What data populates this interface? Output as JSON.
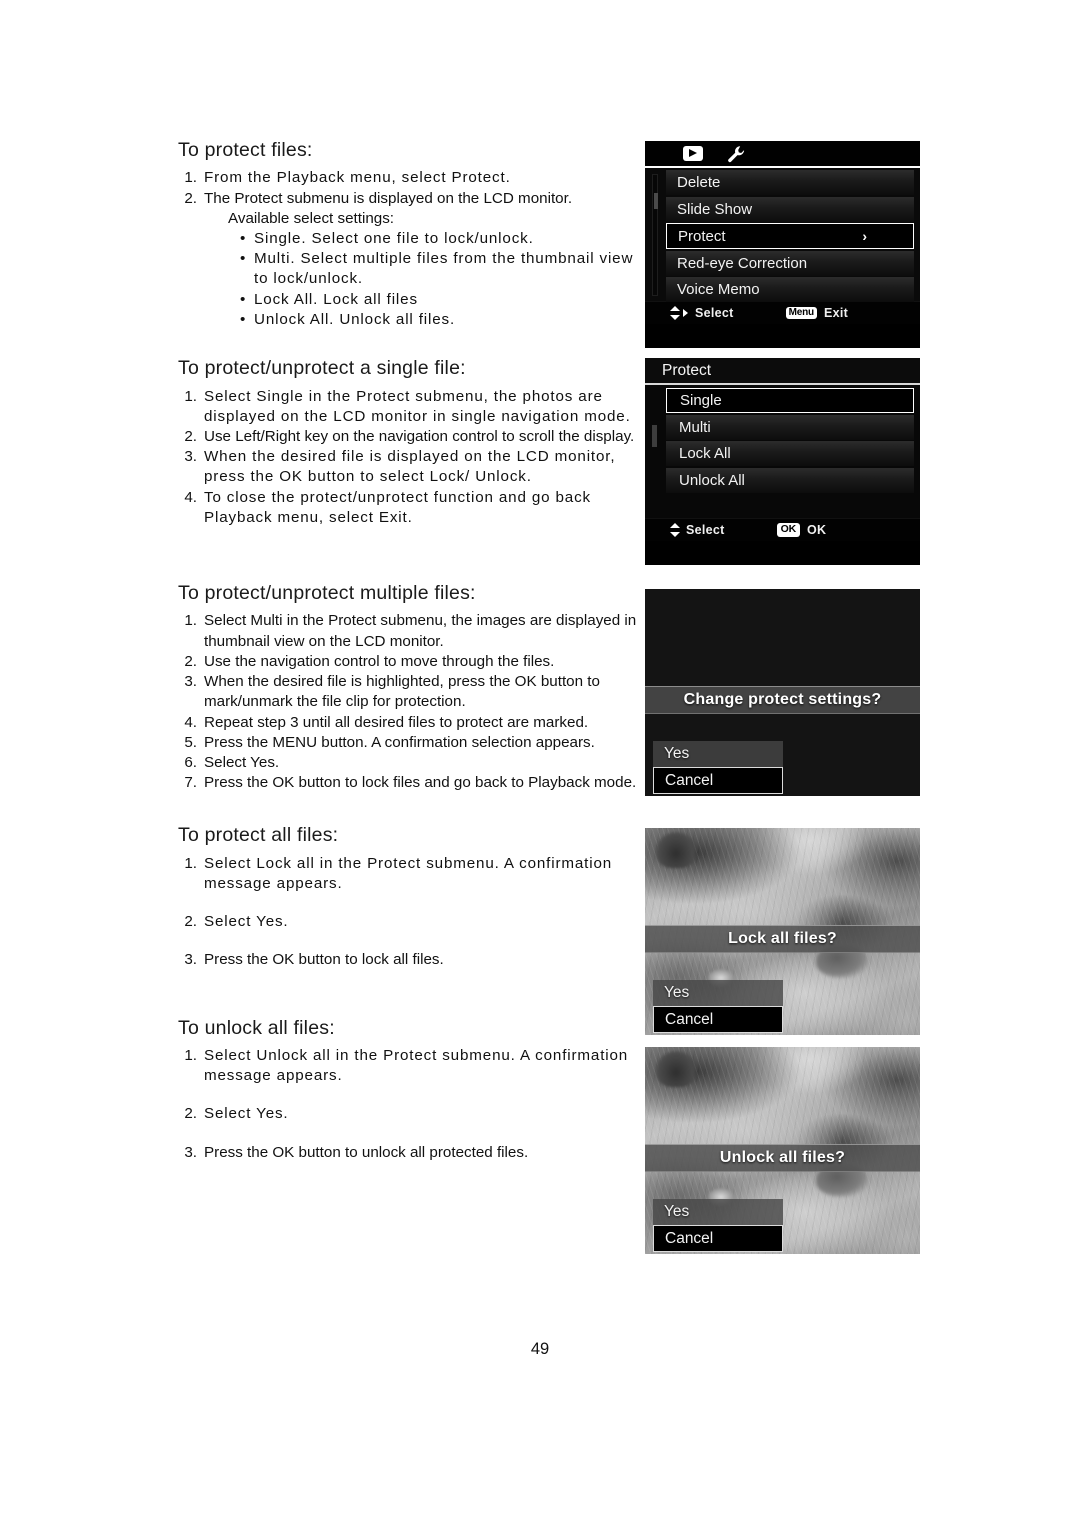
{
  "page": {
    "number": "49"
  },
  "sections": [
    {
      "heading": "To protect files:",
      "steps": [
        {
          "num": "1.",
          "text": "From the Playback menu, select Protect."
        },
        {
          "num": "2.",
          "text": "The Protect submenu is displayed on the LCD monitor."
        }
      ],
      "sub_plain": "Available select settings:",
      "bullets": [
        "Single. Select one file to lock/unlock.",
        "Multi. Select multiple files from the thumbnail view to lock/unlock.",
        "Lock All. Lock all files",
        "Unlock All. Unlock all files."
      ]
    },
    {
      "heading": "To protect/unprotect a single file:",
      "steps": [
        {
          "num": "1.",
          "text": "Select Single in the Protect submenu, the photos are displayed on the LCD monitor in single navigation mode."
        },
        {
          "num": "2.",
          "text": "Use Left/Right key on the navigation control to scroll the display."
        },
        {
          "num": "3.",
          "text": "When the desired file is displayed on the LCD monitor, press the OK button to select Lock/ Unlock."
        },
        {
          "num": "4.",
          "text": "To close the protect/unprotect function and go back Playback menu, select Exit."
        }
      ]
    },
    {
      "heading": "To protect/unprotect multiple files:",
      "steps": [
        {
          "num": "1.",
          "text": "Select Multi in the Protect submenu, the images are displayed in thumbnail view on the LCD monitor."
        },
        {
          "num": "2.",
          "text": "Use the navigation control to move through the files."
        },
        {
          "num": "3.",
          "text": "When the desired file is highlighted, press the OK button to mark/unmark the file clip for protection."
        },
        {
          "num": "4.",
          "text": "Repeat step 3 until all desired files to protect are marked."
        },
        {
          "num": "5.",
          "text": "Press the MENU button. A confirmation selection appears."
        },
        {
          "num": "6.",
          "text": "Select Yes."
        },
        {
          "num": "7.",
          "text": "Press the OK button to lock files and go back to Playback mode."
        }
      ]
    },
    {
      "heading": "To protect all files:",
      "steps": [
        {
          "num": "1.",
          "text": "Select Lock all in the Protect submenu. A confirmation message appears."
        },
        {
          "num": "2.",
          "text": "Select Yes."
        },
        {
          "num": "3.",
          "text": "Press the OK button to lock all files."
        }
      ]
    },
    {
      "heading": "To unlock all files:",
      "steps": [
        {
          "num": "1.",
          "text": "Select Unlock all in the Protect submenu. A confirmation message appears."
        },
        {
          "num": "2.",
          "text": "Select Yes."
        },
        {
          "num": "3.",
          "text": "Press the OK button to unlock all protected files."
        }
      ]
    }
  ],
  "screens": {
    "playback_menu": {
      "tabs": [
        {
          "icon": "playback-icon",
          "active": true
        },
        {
          "icon": "wrench-icon",
          "active": false
        }
      ],
      "items": [
        {
          "label": "Delete",
          "selected": false,
          "chevron": ""
        },
        {
          "label": "Slide Show",
          "selected": false,
          "chevron": ""
        },
        {
          "label": "Protect",
          "selected": true,
          "chevron": "›"
        },
        {
          "label": "Red-eye Correction",
          "selected": false,
          "chevron": ""
        },
        {
          "label": "Voice Memo",
          "selected": false,
          "chevron": ""
        }
      ],
      "status": {
        "left_label": "Select",
        "right_badge": "Menu",
        "right_label": "Exit"
      }
    },
    "protect_submenu": {
      "title": "Protect",
      "items": [
        {
          "label": "Single",
          "selected": true
        },
        {
          "label": "Multi",
          "selected": false
        },
        {
          "label": "Lock All",
          "selected": false
        },
        {
          "label": "Unlock All",
          "selected": false
        }
      ],
      "status": {
        "left_label": "Select",
        "right_badge": "OK",
        "right_label": "OK"
      }
    },
    "confirm_change": {
      "banner": "Change protect settings?",
      "choices": [
        {
          "label": "Yes",
          "selected": false
        },
        {
          "label": "Cancel",
          "selected": true
        }
      ]
    },
    "confirm_lock": {
      "banner": "Lock all files?",
      "choices": [
        {
          "label": "Yes",
          "selected": false
        },
        {
          "label": "Cancel",
          "selected": true
        }
      ]
    },
    "confirm_unlock": {
      "banner": "Unlock all files?",
      "choices": [
        {
          "label": "Yes",
          "selected": false
        },
        {
          "label": "Cancel",
          "selected": true
        }
      ]
    }
  }
}
